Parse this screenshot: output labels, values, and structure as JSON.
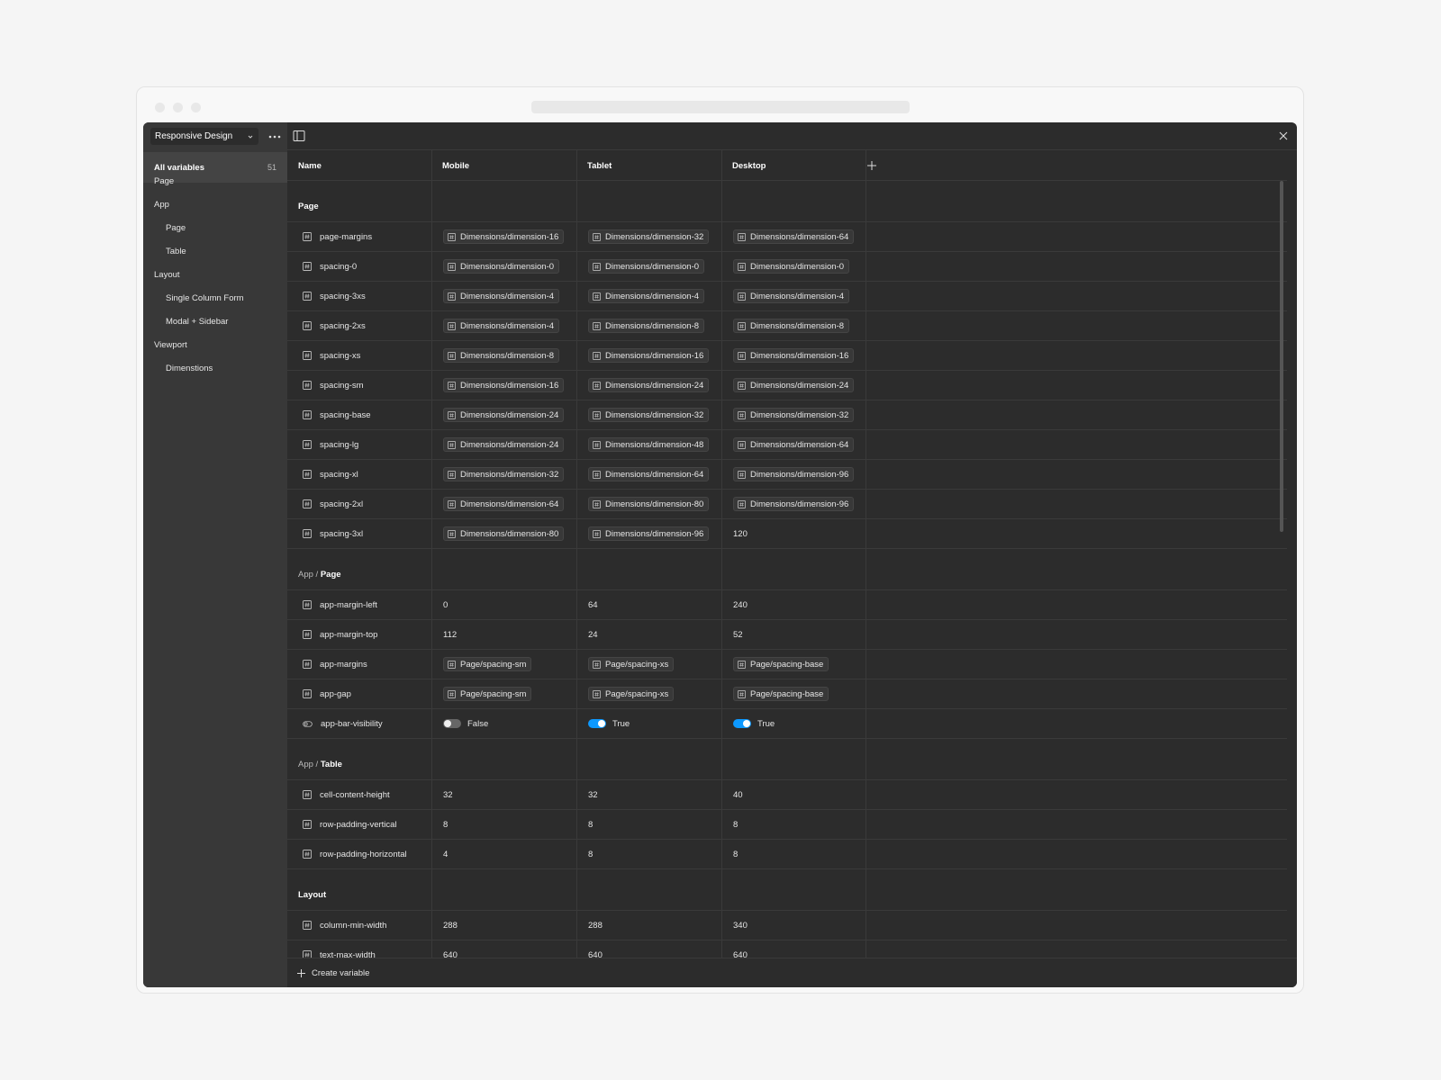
{
  "window": {
    "url": ""
  },
  "collection": {
    "name": "Responsive Design"
  },
  "sidebar": {
    "all_label": "All variables",
    "all_count": "51",
    "items": [
      {
        "label": "Page",
        "indent": 0
      },
      {
        "label": "App",
        "indent": 0
      },
      {
        "label": "Page",
        "indent": 1
      },
      {
        "label": "Table",
        "indent": 1
      },
      {
        "label": "Layout",
        "indent": 0
      },
      {
        "label": "Single Column Form",
        "indent": 1
      },
      {
        "label": "Modal + Sidebar",
        "indent": 1
      },
      {
        "label": "Viewport",
        "indent": 0
      },
      {
        "label": "Dimenstions",
        "indent": 1
      }
    ]
  },
  "table": {
    "columns": [
      "Name",
      "Mobile",
      "Tablet",
      "Desktop"
    ],
    "groups": [
      {
        "parent": "",
        "title": "Page",
        "rows": [
          {
            "name": "page-margins",
            "type": "number",
            "values": [
              {
                "alias": "Dimensions/dimension-16"
              },
              {
                "alias": "Dimensions/dimension-32"
              },
              {
                "alias": "Dimensions/dimension-64"
              }
            ]
          },
          {
            "name": "spacing-0",
            "type": "number",
            "values": [
              {
                "alias": "Dimensions/dimension-0"
              },
              {
                "alias": "Dimensions/dimension-0"
              },
              {
                "alias": "Dimensions/dimension-0"
              }
            ]
          },
          {
            "name": "spacing-3xs",
            "type": "number",
            "values": [
              {
                "alias": "Dimensions/dimension-4"
              },
              {
                "alias": "Dimensions/dimension-4"
              },
              {
                "alias": "Dimensions/dimension-4"
              }
            ]
          },
          {
            "name": "spacing-2xs",
            "type": "number",
            "values": [
              {
                "alias": "Dimensions/dimension-4"
              },
              {
                "alias": "Dimensions/dimension-8"
              },
              {
                "alias": "Dimensions/dimension-8"
              }
            ]
          },
          {
            "name": "spacing-xs",
            "type": "number",
            "values": [
              {
                "alias": "Dimensions/dimension-8"
              },
              {
                "alias": "Dimensions/dimension-16"
              },
              {
                "alias": "Dimensions/dimension-16"
              }
            ]
          },
          {
            "name": "spacing-sm",
            "type": "number",
            "values": [
              {
                "alias": "Dimensions/dimension-16"
              },
              {
                "alias": "Dimensions/dimension-24"
              },
              {
                "alias": "Dimensions/dimension-24"
              }
            ]
          },
          {
            "name": "spacing-base",
            "type": "number",
            "values": [
              {
                "alias": "Dimensions/dimension-24"
              },
              {
                "alias": "Dimensions/dimension-32"
              },
              {
                "alias": "Dimensions/dimension-32"
              }
            ]
          },
          {
            "name": "spacing-lg",
            "type": "number",
            "values": [
              {
                "alias": "Dimensions/dimension-24"
              },
              {
                "alias": "Dimensions/dimension-48"
              },
              {
                "alias": "Dimensions/dimension-64"
              }
            ]
          },
          {
            "name": "spacing-xl",
            "type": "number",
            "values": [
              {
                "alias": "Dimensions/dimension-32"
              },
              {
                "alias": "Dimensions/dimension-64"
              },
              {
                "alias": "Dimensions/dimension-96"
              }
            ]
          },
          {
            "name": "spacing-2xl",
            "type": "number",
            "values": [
              {
                "alias": "Dimensions/dimension-64"
              },
              {
                "alias": "Dimensions/dimension-80"
              },
              {
                "alias": "Dimensions/dimension-96"
              }
            ]
          },
          {
            "name": "spacing-3xl",
            "type": "number",
            "values": [
              {
                "alias": "Dimensions/dimension-80"
              },
              {
                "alias": "Dimensions/dimension-96"
              },
              {
                "text": "120"
              }
            ]
          }
        ]
      },
      {
        "parent": "App",
        "title": "Page",
        "rows": [
          {
            "name": "app-margin-left",
            "type": "number",
            "values": [
              {
                "text": "0"
              },
              {
                "text": "64"
              },
              {
                "text": "240"
              }
            ]
          },
          {
            "name": "app-margin-top",
            "type": "number",
            "values": [
              {
                "text": "112"
              },
              {
                "text": "24"
              },
              {
                "text": "52"
              }
            ]
          },
          {
            "name": "app-margins",
            "type": "number",
            "values": [
              {
                "alias": "Page/spacing-sm"
              },
              {
                "alias": "Page/spacing-xs"
              },
              {
                "alias": "Page/spacing-base"
              }
            ]
          },
          {
            "name": "app-gap",
            "type": "number",
            "values": [
              {
                "alias": "Page/spacing-sm"
              },
              {
                "alias": "Page/spacing-xs"
              },
              {
                "alias": "Page/spacing-base"
              }
            ]
          },
          {
            "name": "app-bar-visibility",
            "type": "boolean",
            "values": [
              {
                "bool": false,
                "text": "False"
              },
              {
                "bool": true,
                "text": "True"
              },
              {
                "bool": true,
                "text": "True"
              }
            ]
          }
        ]
      },
      {
        "parent": "App",
        "title": "Table",
        "rows": [
          {
            "name": "cell-content-height",
            "type": "number",
            "values": [
              {
                "text": "32"
              },
              {
                "text": "32"
              },
              {
                "text": "40"
              }
            ]
          },
          {
            "name": "row-padding-vertical",
            "type": "number",
            "values": [
              {
                "text": "8"
              },
              {
                "text": "8"
              },
              {
                "text": "8"
              }
            ]
          },
          {
            "name": "row-padding-horizontal",
            "type": "number",
            "values": [
              {
                "text": "4"
              },
              {
                "text": "8"
              },
              {
                "text": "8"
              }
            ]
          }
        ]
      },
      {
        "parent": "",
        "title": "Layout",
        "rows": [
          {
            "name": "column-min-width",
            "type": "number",
            "values": [
              {
                "text": "288"
              },
              {
                "text": "288"
              },
              {
                "text": "340"
              }
            ]
          },
          {
            "name": "text-max-width",
            "type": "number",
            "values": [
              {
                "text": "640"
              },
              {
                "text": "640"
              },
              {
                "text": "640"
              }
            ]
          }
        ]
      }
    ]
  },
  "footer": {
    "create_label": "Create variable"
  },
  "colors": {
    "accent": "#0d99ff",
    "background": "#2c2c2c",
    "sidebar": "#383838"
  }
}
